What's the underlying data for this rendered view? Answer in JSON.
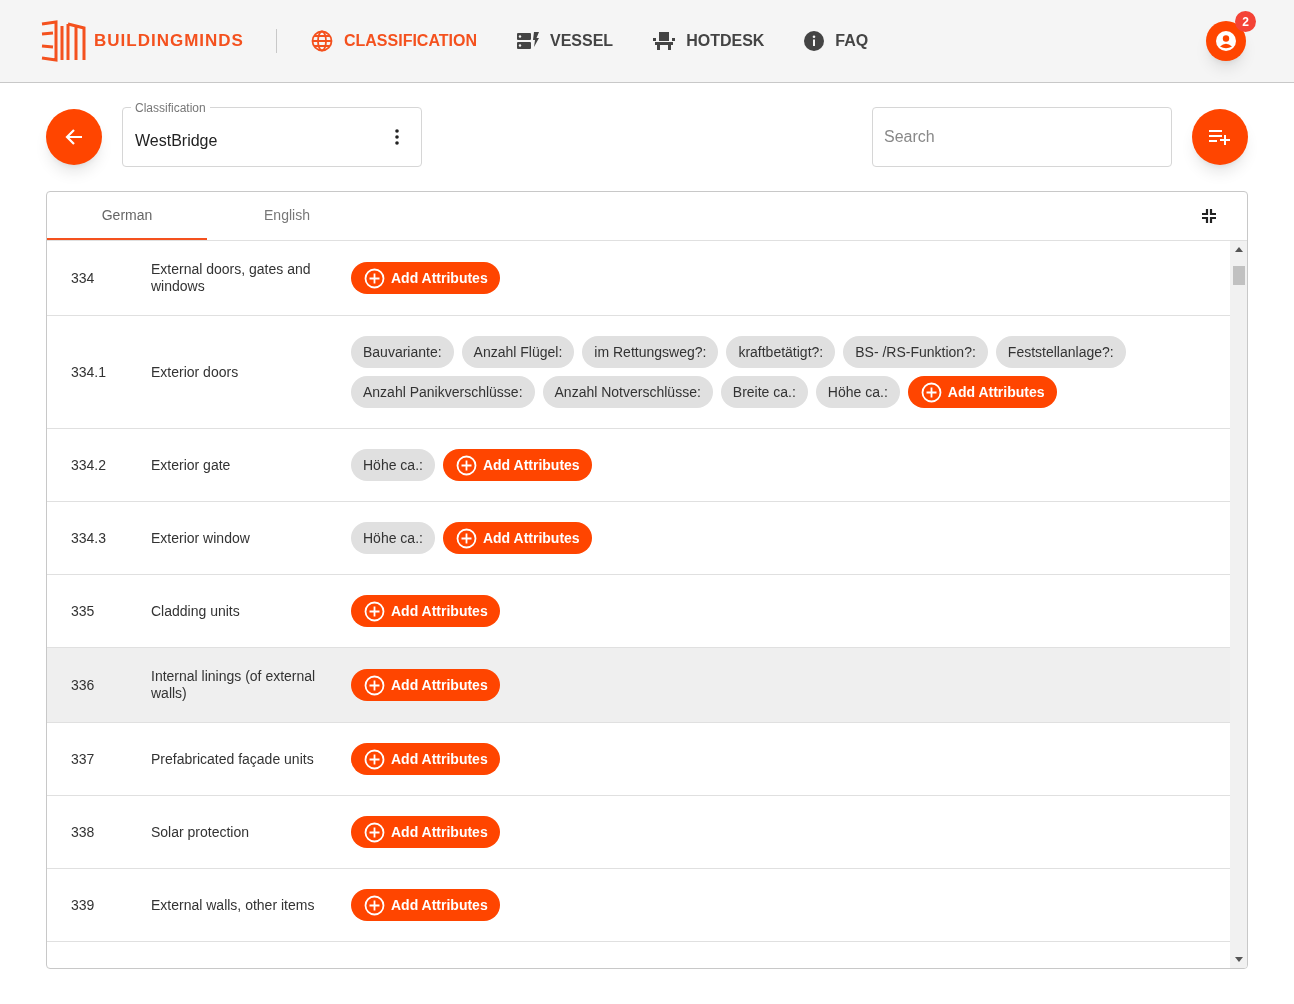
{
  "brand": "BUILDINGMINDS",
  "nav": [
    {
      "label": "CLASSIFICATION",
      "selected": true
    },
    {
      "label": "VESSEL",
      "selected": false
    },
    {
      "label": "HOTDESK",
      "selected": false
    },
    {
      "label": "FAQ",
      "selected": false
    }
  ],
  "notification_count": "2",
  "classification_field": {
    "label": "Classification",
    "value": "WestBridge"
  },
  "search": {
    "placeholder": "Search"
  },
  "tabs": [
    {
      "label": "German",
      "selected": true
    },
    {
      "label": "English",
      "selected": false
    }
  ],
  "rows": [
    {
      "code": "334",
      "name": "External doors, gates and windows",
      "highlighted": false,
      "attributes": [],
      "add_label": "Add Attributes"
    },
    {
      "code": "334.1",
      "name": "Exterior doors",
      "highlighted": false,
      "attributes": [
        "Bauvariante:",
        "Anzahl Flügel:",
        "im Rettungsweg?:",
        "kraftbetätigt?:",
        "BS- /RS-Funktion?:",
        "Feststellanlage?:",
        "Anzahl Panikverschlüsse:",
        "Anzahl Notverschlüsse:",
        "Breite ca.:",
        "Höhe ca.:"
      ],
      "add_label": "Add Attributes"
    },
    {
      "code": "334.2",
      "name": "Exterior gate",
      "highlighted": false,
      "attributes": [
        "Höhe ca.:"
      ],
      "add_label": "Add Attributes"
    },
    {
      "code": "334.3",
      "name": "Exterior window",
      "highlighted": false,
      "attributes": [
        "Höhe ca.:"
      ],
      "add_label": "Add Attributes"
    },
    {
      "code": "335",
      "name": "Cladding units",
      "highlighted": false,
      "attributes": [],
      "add_label": "Add Attributes"
    },
    {
      "code": "336",
      "name": "Internal linings (of external walls)",
      "highlighted": true,
      "attributes": [],
      "add_label": "Add Attributes"
    },
    {
      "code": "337",
      "name": "Prefabricated façade units",
      "highlighted": false,
      "attributes": [],
      "add_label": "Add Attributes"
    },
    {
      "code": "338",
      "name": "Solar protection",
      "highlighted": false,
      "attributes": [],
      "add_label": "Add Attributes"
    },
    {
      "code": "339",
      "name": "External walls, other items",
      "highlighted": false,
      "attributes": [],
      "add_label": "Add Attributes"
    }
  ]
}
